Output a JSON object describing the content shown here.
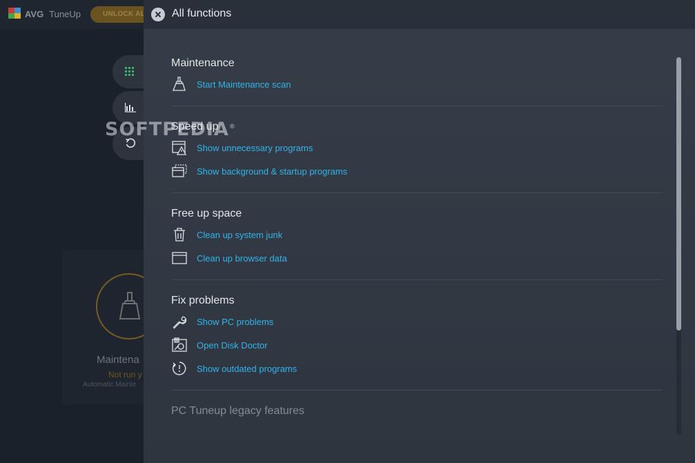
{
  "app": {
    "logo_text": "AVG",
    "product_name": "TuneUp",
    "unlock_label": "UNLOCK AL",
    "maintenance_card": {
      "title": "Maintena",
      "status": "Not run y",
      "subtitle": "Automatic Mainte"
    },
    "colors": {
      "accent_green": "#3fae6a",
      "accent_gold": "#7a5a24"
    }
  },
  "panel": {
    "title": "All functions",
    "sections": [
      {
        "title": "Maintenance",
        "items": [
          {
            "label": "Start Maintenance scan",
            "icon": "broom-icon"
          }
        ]
      },
      {
        "title": "Speed up",
        "items": [
          {
            "label": "Show unnecessary programs",
            "icon": "window-warning-icon"
          },
          {
            "label": "Show background & startup programs",
            "icon": "stacked-windows-icon"
          }
        ]
      },
      {
        "title": "Free up space",
        "items": [
          {
            "label": "Clean up system junk",
            "icon": "trash-icon"
          },
          {
            "label": "Clean up browser data",
            "icon": "browser-window-icon"
          }
        ]
      },
      {
        "title": "Fix problems",
        "items": [
          {
            "label": "Show PC problems",
            "icon": "wrench-icon"
          },
          {
            "label": "Open Disk Doctor",
            "icon": "disk-doctor-icon"
          },
          {
            "label": "Show outdated programs",
            "icon": "outdated-clock-icon"
          }
        ]
      }
    ],
    "legacy_title": "PC Tuneup legacy features",
    "link_color": "#34b3ea"
  },
  "watermark": "SOFTPEDIA"
}
